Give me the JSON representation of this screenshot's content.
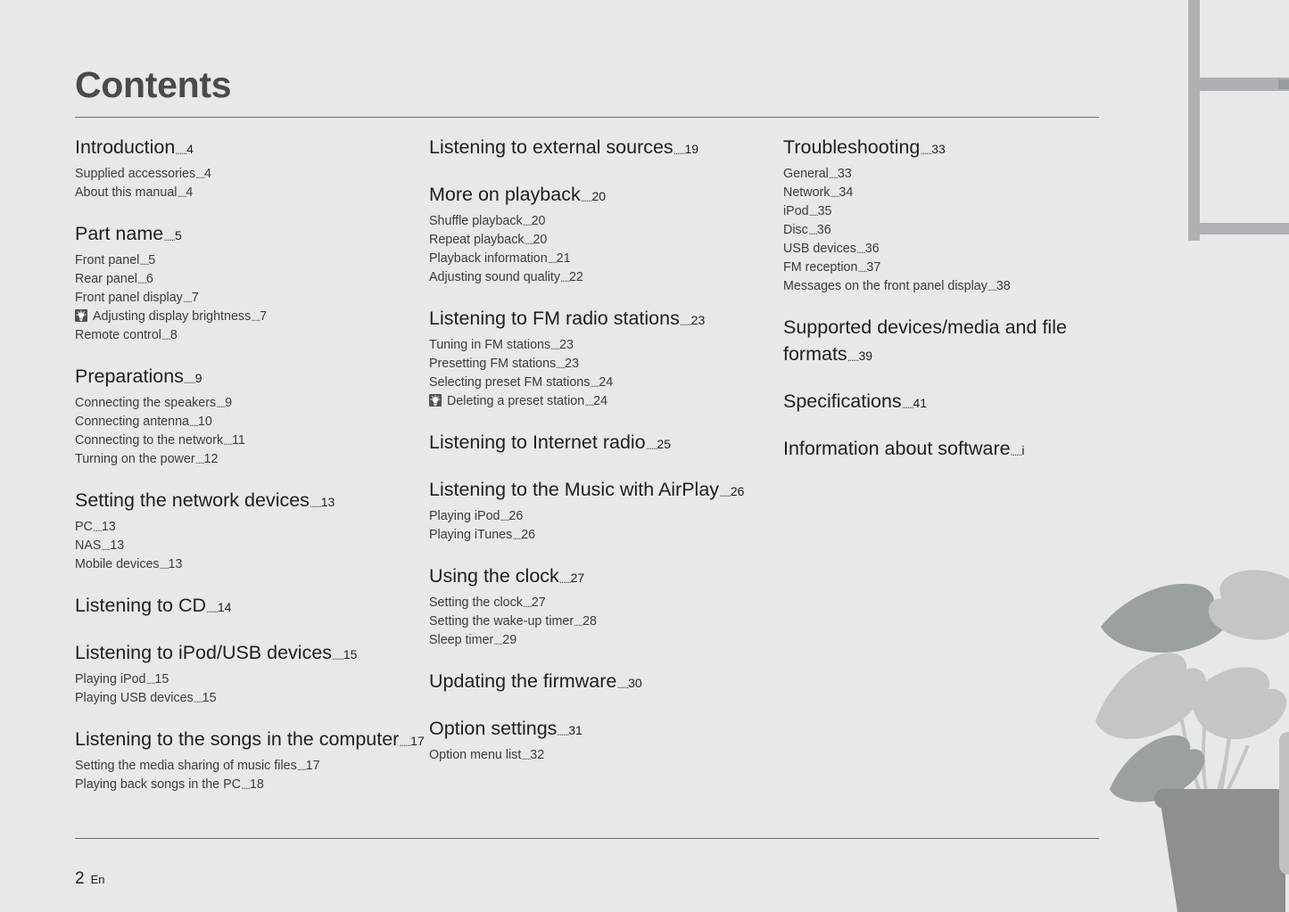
{
  "page": {
    "title": "Contents",
    "footer_number": "2",
    "footer_lang": "En",
    "leader": "......"
  },
  "colors": {
    "background": "#e8e8e8",
    "heading_text": "#1f1f1f",
    "sub_text": "#3c3c3c",
    "title_text": "#4a4a4a",
    "rule": "#6e6e6e",
    "tip_icon_bg": "#4f5052",
    "plant_dark": "#8c9093",
    "plant_mid": "#a8acaf",
    "plant_light": "#c3c5c7",
    "frame": "#aeb1b4",
    "frame_latch": "#979b9e"
  },
  "columns": [
    {
      "name": "column-left",
      "groups": [
        {
          "heading": {
            "label": "Introduction",
            "page": "4"
          },
          "items": [
            {
              "label": "Supplied accessories",
              "page": "4",
              "icon": null
            },
            {
              "label": "About this manual",
              "page": "4",
              "icon": null
            }
          ]
        },
        {
          "heading": {
            "label": "Part name",
            "page": "5"
          },
          "items": [
            {
              "label": "Front panel",
              "page": "5",
              "icon": null
            },
            {
              "label": "Rear panel",
              "page": "6",
              "icon": null
            },
            {
              "label": "Front panel display",
              "page": "7",
              "icon": null
            },
            {
              "label": "Adjusting display brightness",
              "page": "7",
              "icon": "tip-bulb-icon"
            },
            {
              "label": "Remote control",
              "page": "8",
              "icon": null
            }
          ]
        },
        {
          "heading": {
            "label": "Preparations",
            "page": "9"
          },
          "items": [
            {
              "label": "Connecting the speakers",
              "page": "9",
              "icon": null
            },
            {
              "label": "Connecting antenna",
              "page": "10",
              "icon": null
            },
            {
              "label": "Connecting to the network",
              "page": "11",
              "icon": null
            },
            {
              "label": "Turning on the power",
              "page": "12",
              "icon": null
            }
          ]
        },
        {
          "heading": {
            "label": "Setting the network devices",
            "page": "13"
          },
          "items": [
            {
              "label": "PC",
              "page": "13",
              "icon": null
            },
            {
              "label": "NAS",
              "page": "13",
              "icon": null
            },
            {
              "label": "Mobile devices",
              "page": "13",
              "icon": null
            }
          ]
        },
        {
          "heading": {
            "label": "Listening to CD",
            "page": "14"
          },
          "items": []
        },
        {
          "heading": {
            "label": "Listening to iPod/USB devices",
            "page": "15"
          },
          "items": [
            {
              "label": "Playing iPod",
              "page": "15",
              "icon": null
            },
            {
              "label": "Playing USB devices",
              "page": "15",
              "icon": null
            }
          ]
        },
        {
          "heading": {
            "label": "Listening to the songs in the computer",
            "page": "17"
          },
          "items": [
            {
              "label": "Setting the media sharing of music files",
              "page": "17",
              "icon": null
            },
            {
              "label": "Playing back songs in the PC",
              "page": "18",
              "icon": null
            }
          ]
        }
      ]
    },
    {
      "name": "column-middle",
      "groups": [
        {
          "heading": {
            "label": "Listening to external sources",
            "page": "19"
          },
          "items": []
        },
        {
          "heading": {
            "label": "More on playback",
            "page": "20"
          },
          "items": [
            {
              "label": "Shuffle playback",
              "page": "20",
              "icon": null
            },
            {
              "label": "Repeat playback",
              "page": "20",
              "icon": null
            },
            {
              "label": "Playback information",
              "page": "21",
              "icon": null
            },
            {
              "label": "Adjusting sound quality",
              "page": "22",
              "icon": null
            }
          ]
        },
        {
          "heading": {
            "label": "Listening to FM radio stations",
            "page": "23"
          },
          "items": [
            {
              "label": "Tuning in FM stations",
              "page": "23",
              "icon": null
            },
            {
              "label": "Presetting FM stations",
              "page": "23",
              "icon": null
            },
            {
              "label": "Selecting preset FM stations",
              "page": "24",
              "icon": null
            },
            {
              "label": "Deleting a preset station",
              "page": "24",
              "icon": "tip-bulb-icon"
            }
          ]
        },
        {
          "heading": {
            "label": "Listening to Internet radio",
            "page": "25"
          },
          "items": []
        },
        {
          "heading": {
            "label": "Listening to the Music with AirPlay",
            "page": "26"
          },
          "items": [
            {
              "label": "Playing iPod",
              "page": "26",
              "icon": null
            },
            {
              "label": "Playing iTunes",
              "page": "26",
              "icon": null
            }
          ]
        },
        {
          "heading": {
            "label": "Using the clock",
            "page": "27"
          },
          "items": [
            {
              "label": "Setting the clock",
              "page": "27",
              "icon": null
            },
            {
              "label": "Setting the wake-up timer",
              "page": "28",
              "icon": null
            },
            {
              "label": "Sleep timer",
              "page": "29",
              "icon": null
            }
          ]
        },
        {
          "heading": {
            "label": "Updating the firmware",
            "page": "30"
          },
          "items": []
        },
        {
          "heading": {
            "label": "Option settings",
            "page": "31"
          },
          "items": [
            {
              "label": "Option menu list",
              "page": "32",
              "icon": null
            }
          ]
        }
      ]
    },
    {
      "name": "column-right",
      "groups": [
        {
          "heading": {
            "label": "Troubleshooting",
            "page": "33"
          },
          "items": [
            {
              "label": "General",
              "page": "33",
              "icon": null
            },
            {
              "label": "Network",
              "page": "34",
              "icon": null
            },
            {
              "label": "iPod",
              "page": "35",
              "icon": null
            },
            {
              "label": "Disc",
              "page": "36",
              "icon": null
            },
            {
              "label": "USB devices",
              "page": "36",
              "icon": null
            },
            {
              "label": "FM reception",
              "page": "37",
              "icon": null
            },
            {
              "label": "Messages on the front panel display",
              "page": "38",
              "icon": null
            }
          ]
        },
        {
          "heading": {
            "label": "Supported devices/media and file formats",
            "page": "39"
          },
          "items": []
        },
        {
          "heading": {
            "label": "Specifications",
            "page": "41"
          },
          "items": []
        },
        {
          "heading": {
            "label": "Information about software",
            "page": "i"
          },
          "items": []
        }
      ]
    }
  ]
}
